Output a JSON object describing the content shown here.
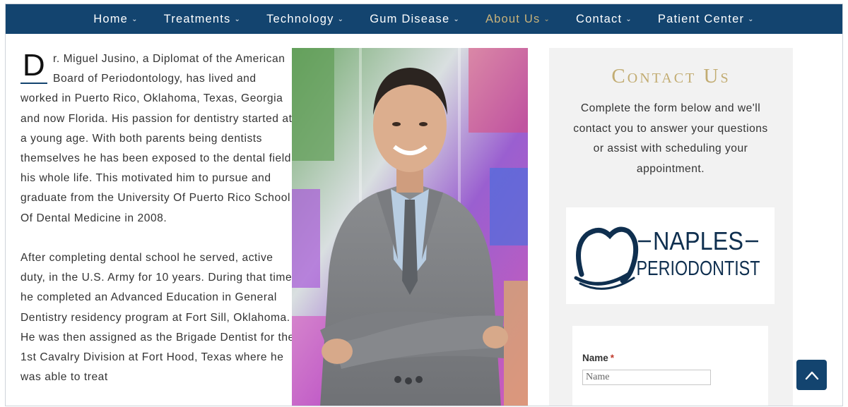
{
  "nav": {
    "items": [
      {
        "label": "Home",
        "chevron": "⌄"
      },
      {
        "label": "Treatments",
        "chevron": "⌄"
      },
      {
        "label": "Technology",
        "chevron": "⌄"
      },
      {
        "label": "Gum Disease",
        "chevron": "⌄"
      },
      {
        "label": "About Us",
        "chevron": "⌄",
        "active": true
      },
      {
        "label": "Contact",
        "chevron": "⌄"
      },
      {
        "label": "Patient Center",
        "chevron": "⌄"
      }
    ]
  },
  "bio": {
    "dropcap": "D",
    "paragraph1_rest": "r. Miguel Jusino, a Diplomat of the American Board of Periodontology, has lived and worked in Puerto Rico, Oklahoma, Texas, Georgia and now Florida. His passion for dentistry started at a young age. With both parents being dentists themselves he has been exposed to the dental field his whole life. This motivated him to pursue and graduate from the University Of Puerto Rico School Of Dental Medicine in 2008.",
    "paragraph2": "After completing dental school he served, active duty, in the U.S. Army for 10 years. During that time he completed an Advanced Education in General Dentistry residency program at Fort Sill, Oklahoma. He was then assigned as the Brigade Dentist for the 1st Cavalry Division at Fort Hood, Texas where he was able to treat"
  },
  "sidebar": {
    "title": "Contact Us",
    "description": "Complete the form below and we'll contact you to answer your questions or assist with scheduling your appointment.",
    "logo": {
      "line1": "NAPLES",
      "line2": "PERIODONTIST"
    },
    "form": {
      "name_label": "Name",
      "required_mark": "*",
      "name_placeholder": "Name"
    }
  },
  "colors": {
    "navy": "#13446f",
    "gold": "#c2ac72",
    "sidebar_bg": "#f2f2f2"
  },
  "icons": {
    "back_to_top": "chevron-up-icon"
  }
}
